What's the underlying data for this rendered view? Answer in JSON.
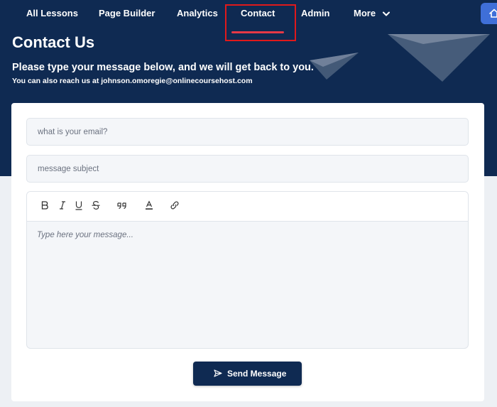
{
  "nav": {
    "items": [
      {
        "label": "All Lessons"
      },
      {
        "label": "Page Builder"
      },
      {
        "label": "Analytics"
      },
      {
        "label": "Contact",
        "active": true
      },
      {
        "label": "Admin"
      },
      {
        "label": "More"
      }
    ],
    "more_icon": "chevron-down-icon",
    "home_icon": "home-icon"
  },
  "header": {
    "title": "Contact Us",
    "subtitle": "Please type your message below, and we will get back to you.",
    "reach_text": "You can also reach us at johnson.omoregie@onlinecoursehost.com"
  },
  "form": {
    "email_placeholder": "what is your email?",
    "email_value": "",
    "subject_placeholder": "message subject",
    "subject_value": "",
    "editor_placeholder": "Type here your message...",
    "toolbar": [
      "bold-icon",
      "italic-icon",
      "underline-icon",
      "strikethrough-icon",
      "quote-icon",
      "text-color-icon",
      "link-icon"
    ],
    "send_label": "Send Message",
    "send_icon": "send-icon"
  },
  "colors": {
    "header_bg": "#0f2a52",
    "accent_underline": "#e63946",
    "highlight_box": "#e0191b",
    "home_button": "#3f6fd8",
    "send_button": "#0f2a52"
  }
}
